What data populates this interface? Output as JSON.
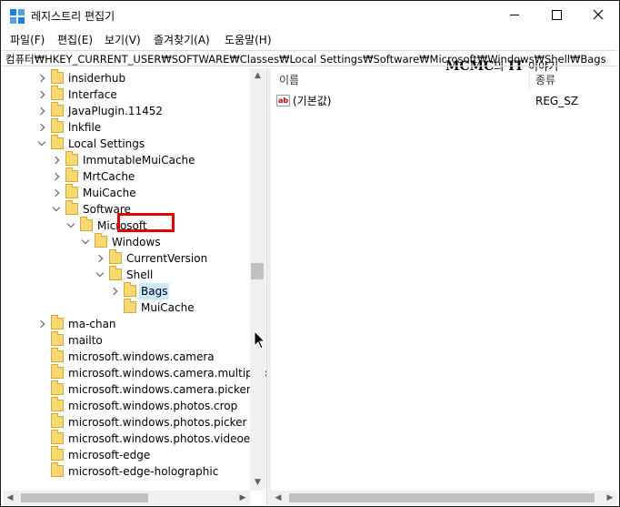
{
  "window": {
    "title": "레지스트리 편집기"
  },
  "menu": [
    "파일(F)",
    "편집(E)",
    "보기(V)",
    "즐겨찾기(A)",
    "도움말(H)"
  ],
  "watermark": {
    "brand": "MCMC",
    "middle": "의",
    "it": "IT",
    "tail": "이야기"
  },
  "address": "컴퓨터₩HKEY_CURRENT_USER₩SOFTWARE₩Classes₩Local Settings₩Software₩Microsoft₩Windows₩Shell₩Bags",
  "tree": [
    {
      "label": "insiderhub",
      "level": 0,
      "state": "collapsed"
    },
    {
      "label": "Interface",
      "level": 0,
      "state": "collapsed"
    },
    {
      "label": "JavaPlugin.11452",
      "level": 0,
      "state": "collapsed"
    },
    {
      "label": "lnkfile",
      "level": 0,
      "state": "collapsed"
    },
    {
      "label": "Local Settings",
      "level": 0,
      "state": "expanded"
    },
    {
      "label": "ImmutableMuiCache",
      "level": 1,
      "state": "collapsed"
    },
    {
      "label": "MrtCache",
      "level": 1,
      "state": "collapsed"
    },
    {
      "label": "MuiCache",
      "level": 1,
      "state": "collapsed"
    },
    {
      "label": "Software",
      "level": 1,
      "state": "expanded"
    },
    {
      "label": "Microsoft",
      "level": 2,
      "state": "expanded"
    },
    {
      "label": "Windows",
      "level": 3,
      "state": "expanded"
    },
    {
      "label": "CurrentVersion",
      "level": 4,
      "state": "collapsed"
    },
    {
      "label": "Shell",
      "level": 4,
      "state": "expanded"
    },
    {
      "label": "Bags",
      "level": 5,
      "state": "collapsed",
      "selected": true
    },
    {
      "label": "MuiCache",
      "level": 5,
      "state": "none"
    },
    {
      "label": "ma-chan",
      "level": 0,
      "state": "collapsed"
    },
    {
      "label": "mailto",
      "level": 0,
      "state": "none"
    },
    {
      "label": "microsoft.windows.camera",
      "level": 0,
      "state": "none"
    },
    {
      "label": "microsoft.windows.camera.multipicke",
      "level": 0,
      "state": "none"
    },
    {
      "label": "microsoft.windows.camera.picker",
      "level": 0,
      "state": "none"
    },
    {
      "label": "microsoft.windows.photos.crop",
      "level": 0,
      "state": "none"
    },
    {
      "label": "microsoft.windows.photos.picker",
      "level": 0,
      "state": "none"
    },
    {
      "label": "microsoft.windows.photos.videoedit",
      "level": 0,
      "state": "none"
    },
    {
      "label": "microsoft-edge",
      "level": 0,
      "state": "none"
    },
    {
      "label": "microsoft-edge-holographic",
      "level": 0,
      "state": "none"
    }
  ],
  "list": {
    "columns": [
      "이름",
      "종류"
    ],
    "rows": [
      {
        "name": "(기본값)",
        "type": "REG_SZ",
        "icon_text": "ab"
      }
    ]
  },
  "colors": {
    "selected_bg": "#cce8ff",
    "highlight": "#e00000",
    "folder": "#f8d775"
  }
}
